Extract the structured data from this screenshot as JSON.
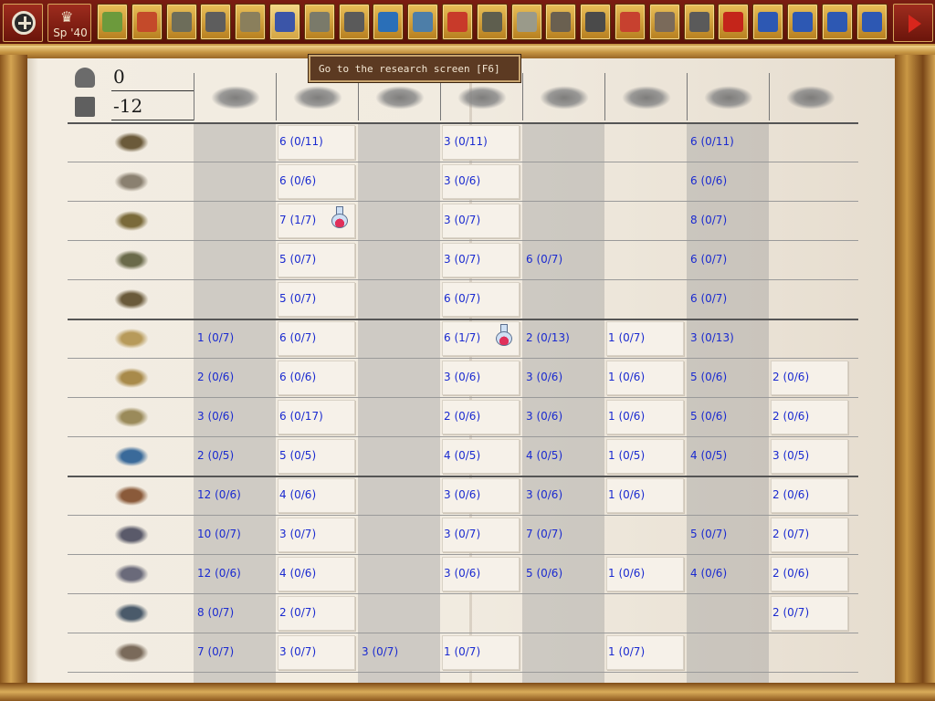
{
  "toolbar": {
    "season_label": "Sp '40",
    "buttons": [
      "map",
      "settings-fire",
      "helmet",
      "truck",
      "buildings",
      "research",
      "factory",
      "tools",
      "globe",
      "diplomacy",
      "flag",
      "tank",
      "bunker",
      "soldiers",
      "rail",
      "pie-chart",
      "grid-add",
      "grid",
      "rewind",
      "document",
      "document-edit",
      "save",
      "exit",
      "next"
    ],
    "active_button": "research"
  },
  "tooltip": {
    "text": "Go to the research screen [F6]"
  },
  "stats": {
    "supply": "0",
    "industry": "-12"
  },
  "columns": [
    "movement",
    "maneuver",
    "transport",
    "soft-attack",
    "naval-attack",
    "hard-attack",
    "armor-attack",
    "air-attack"
  ],
  "rows": [
    {
      "unit": "infantry",
      "cells": [
        "",
        "6 (0/11)",
        "",
        "3 (0/11)",
        "",
        "",
        "6 (0/11)",
        ""
      ]
    },
    {
      "unit": "paratrooper",
      "cells": [
        "",
        "6 (0/6)",
        "",
        "3 (0/6)",
        "",
        "",
        "6 (0/6)",
        ""
      ]
    },
    {
      "unit": "tank",
      "cells": [
        "",
        "7 (1/7)",
        "",
        "3 (0/7)",
        "",
        "",
        "8 (0/7)",
        ""
      ]
    },
    {
      "unit": "artillery",
      "cells": [
        "",
        "5 (0/7)",
        "",
        "3 (0/7)",
        "6 (0/7)",
        "",
        "6 (0/7)",
        ""
      ]
    },
    {
      "unit": "anti-aircraft",
      "cells": [
        "",
        "5 (0/7)",
        "",
        "6 (0/7)",
        "",
        "",
        "6 (0/7)",
        ""
      ]
    },
    {
      "unit": "fighter",
      "cells": [
        "1 (0/7)",
        "6 (0/7)",
        "",
        "6 (1/7)",
        "2 (0/13)",
        "1 (0/7)",
        "3 (0/13)",
        ""
      ]
    },
    {
      "unit": "dive-bomber",
      "cells": [
        "2 (0/6)",
        "6 (0/6)",
        "",
        "3 (0/6)",
        "3 (0/6)",
        "1 (0/6)",
        "5 (0/6)",
        "2 (0/6)"
      ]
    },
    {
      "unit": "bomber",
      "cells": [
        "3 (0/6)",
        "6 (0/17)",
        "",
        "2 (0/6)",
        "3 (0/6)",
        "1 (0/6)",
        "5 (0/6)",
        "2 (0/6)"
      ]
    },
    {
      "unit": "heavy-bomber",
      "cells": [
        "2 (0/5)",
        "5 (0/5)",
        "",
        "4 (0/5)",
        "4 (0/5)",
        "1 (0/5)",
        "4 (0/5)",
        "3 (0/5)"
      ]
    },
    {
      "unit": "carrier",
      "cells": [
        "12 (0/6)",
        "4 (0/6)",
        "",
        "3 (0/6)",
        "3 (0/6)",
        "1 (0/6)",
        "",
        "2 (0/6)"
      ]
    },
    {
      "unit": "battleship",
      "cells": [
        "10 (0/7)",
        "3 (0/7)",
        "",
        "3 (0/7)",
        "7 (0/7)",
        "",
        "5 (0/7)",
        "2 (0/7)"
      ]
    },
    {
      "unit": "cruiser",
      "cells": [
        "12 (0/6)",
        "4 (0/6)",
        "",
        "3 (0/6)",
        "5 (0/6)",
        "1 (0/6)",
        "4 (0/6)",
        "2 (0/6)"
      ]
    },
    {
      "unit": "submarine",
      "cells": [
        "8 (0/7)",
        "2 (0/7)",
        "",
        "",
        "",
        "",
        "",
        "2 (0/7)"
      ]
    },
    {
      "unit": "transport-ship",
      "cells": [
        "7 (0/7)",
        "3 (0/7)",
        "3 (0/7)",
        "1 (0/7)",
        "",
        "1 (0/7)",
        "",
        ""
      ]
    }
  ],
  "research_flasks": [
    {
      "row": 2,
      "col": 1
    },
    {
      "row": 5,
      "col": 3
    }
  ]
}
